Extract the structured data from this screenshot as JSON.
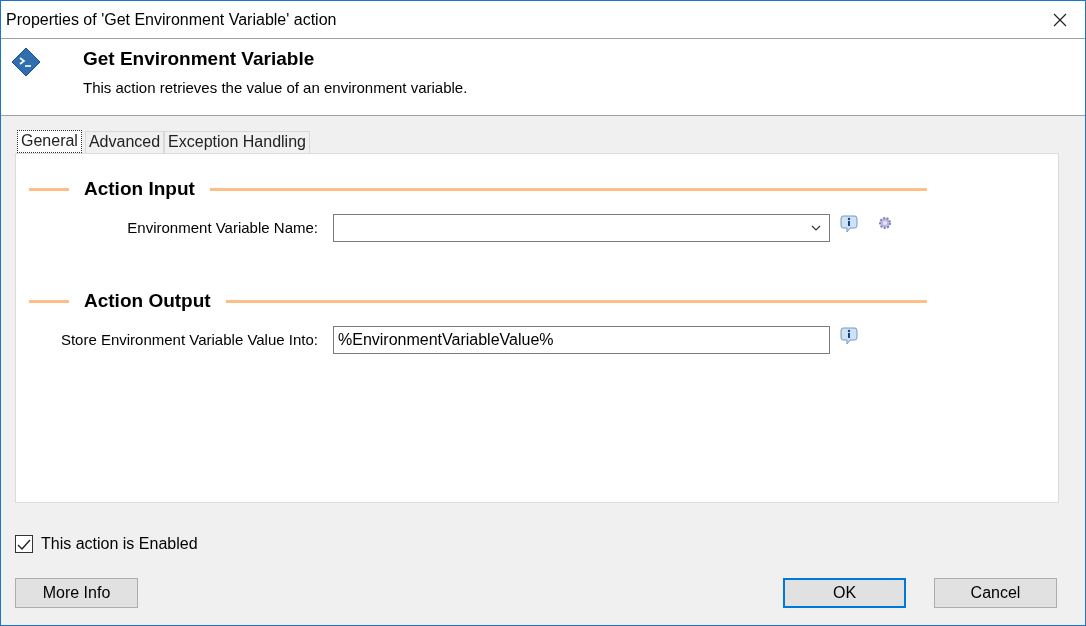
{
  "window": {
    "title": "Properties of 'Get Environment Variable' action"
  },
  "header": {
    "title": "Get Environment Variable",
    "description": "This action retrieves the value of an environment variable."
  },
  "tabs": [
    {
      "label": "General",
      "selected": true
    },
    {
      "label": "Advanced",
      "selected": false
    },
    {
      "label": "Exception Handling",
      "selected": false
    }
  ],
  "sections": [
    {
      "title": "Action Input",
      "fields": [
        {
          "label": "Environment Variable Name:",
          "kind": "dropdown",
          "settings_button": true
        }
      ]
    },
    {
      "title": "Action Output",
      "fields": [
        {
          "label": "Store Environment Variable Value Into:",
          "kind": "text",
          "value": "%EnvironmentVariableValue%",
          "settings_button": false
        }
      ]
    }
  ],
  "enabled_checkbox": {
    "label": "This action is Enabled",
    "checked": true
  },
  "buttons_left": [
    {
      "label": "More Info",
      "default": false
    }
  ],
  "buttons_right": [
    {
      "label": "OK",
      "default": true
    },
    {
      "label": "Cancel",
      "default": false
    }
  ]
}
